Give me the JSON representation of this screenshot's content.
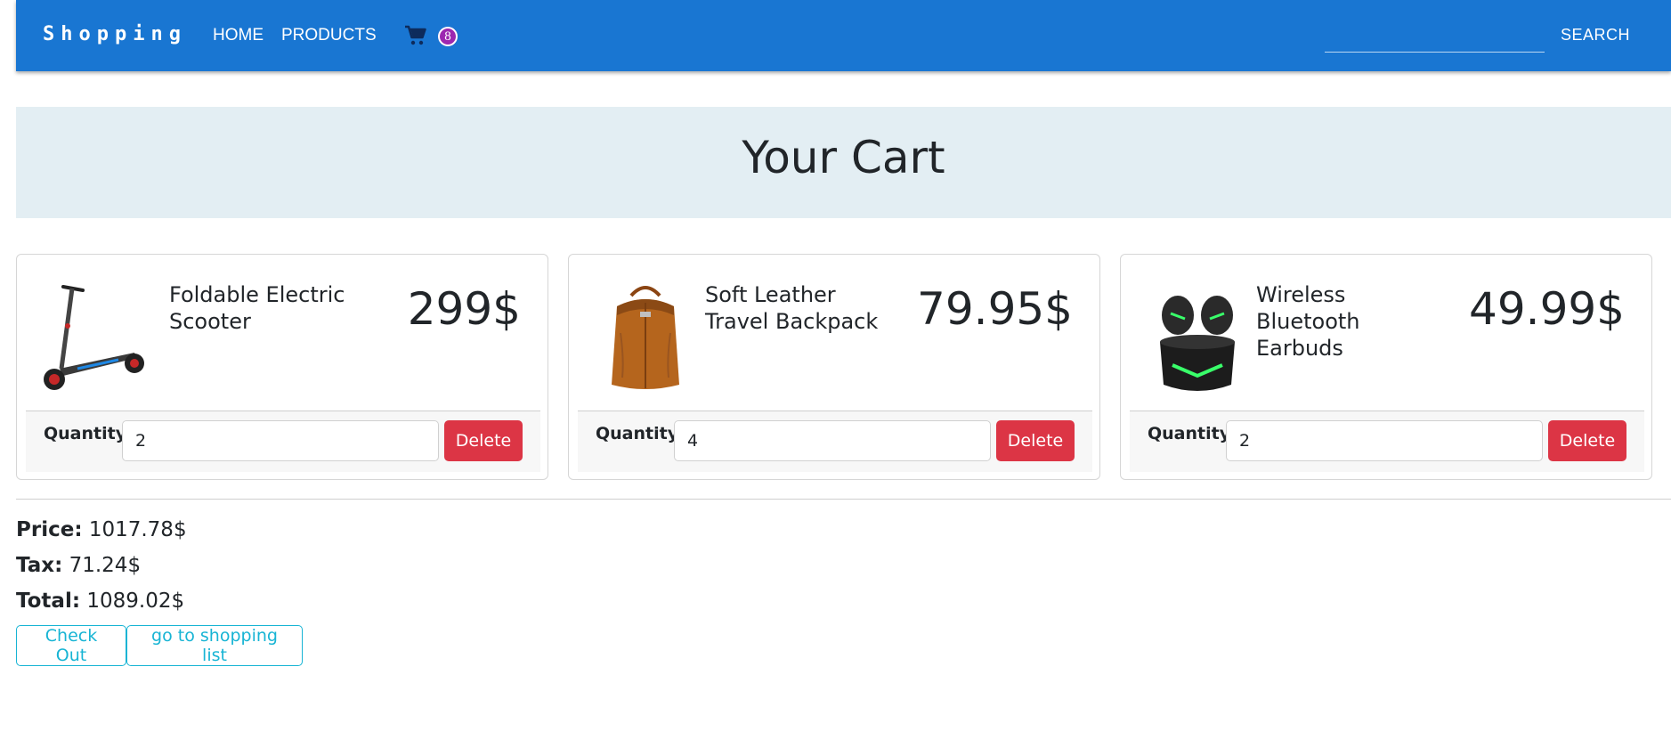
{
  "nav": {
    "brand": "Shopping",
    "home": "HOME",
    "products": "PRODUCTS",
    "cart_count": "8",
    "search_value": "",
    "search_label": "SEARCH"
  },
  "colors": {
    "navbar": "#1976d2",
    "badge": "#9c27b0",
    "hero": "#e3eef3",
    "delete": "#dc3545",
    "outline": "#17b4d4"
  },
  "page_title": "Your Cart",
  "cart_items": [
    {
      "name": "Foldable Electric Scooter",
      "price": "299$",
      "quantity_label": "Quantity",
      "quantity": "2",
      "delete_label": "Delete",
      "image": "scooter-image"
    },
    {
      "name": "Soft Leather Travel Backpack",
      "price": "79.95$",
      "quantity_label": "Quantity",
      "quantity": "4",
      "delete_label": "Delete",
      "image": "backpack-image"
    },
    {
      "name": "Wireless Bluetooth Earbuds",
      "price": "49.99$",
      "quantity_label": "Quantity",
      "quantity": "2",
      "delete_label": "Delete",
      "image": "earbuds-image"
    }
  ],
  "summary": {
    "price_label": "Price:",
    "price_value": "1017.78$",
    "tax_label": "Tax:",
    "tax_value": "71.24$",
    "total_label": "Total:",
    "total_value": "1089.02$"
  },
  "actions": {
    "checkout": "Check Out",
    "shopping_list": "go to shopping list"
  }
}
